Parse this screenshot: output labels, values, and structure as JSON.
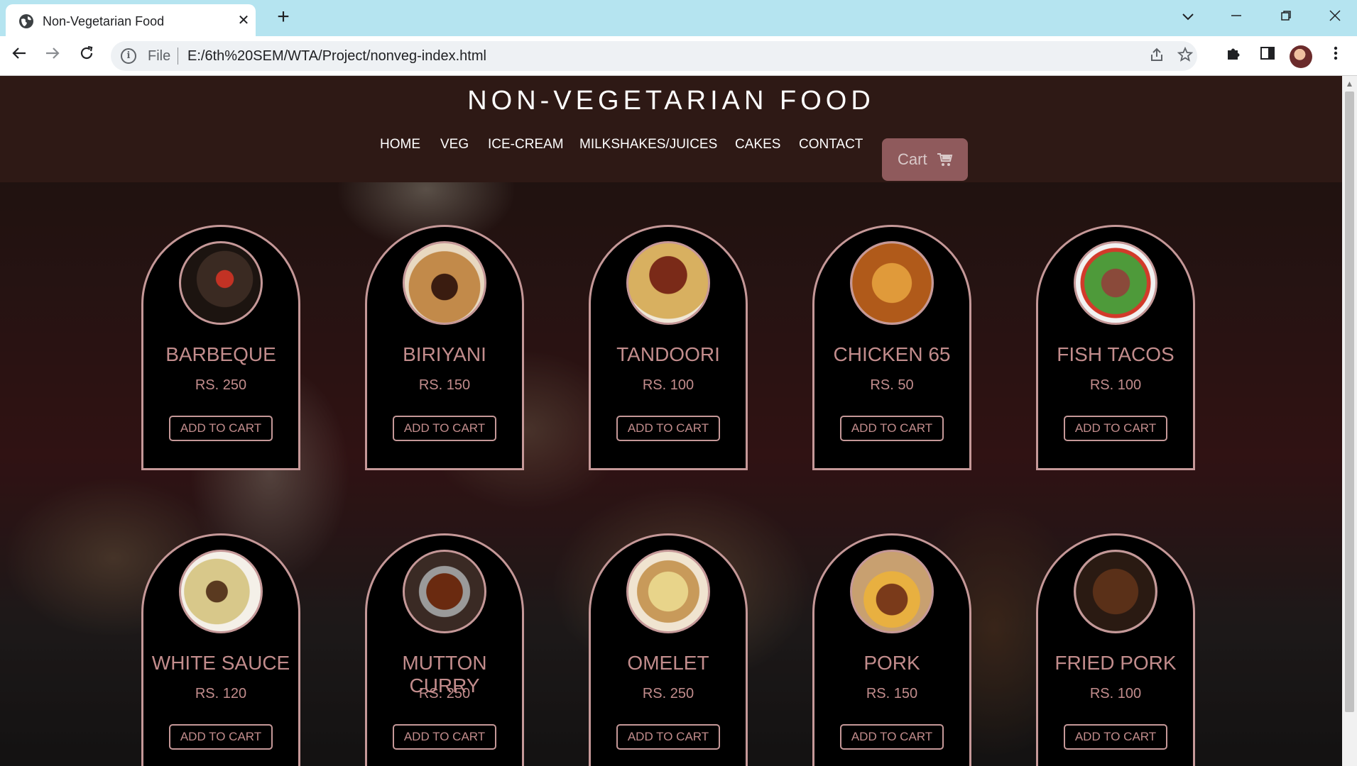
{
  "browser": {
    "tab_title": "Non-Vegetarian Food",
    "tab_close": "✕",
    "new_tab": "+",
    "file_label": "File",
    "url": "E:/6th%20SEM/WTA/Project/nonveg-index.html",
    "icons": [
      "globe-icon",
      "back-icon",
      "forward-icon",
      "reload-icon",
      "info-icon",
      "share-icon",
      "star-icon",
      "extensions-icon",
      "sidepanel-icon",
      "menu-icon",
      "minimize-icon",
      "restore-icon",
      "close-icon"
    ]
  },
  "header": {
    "title": "NON-VEGETARIAN FOOD",
    "nav": [
      "HOME",
      "VEG",
      "ICE-CREAM",
      "MILKSHAKES/JUICES",
      "CAKES",
      "CONTACT"
    ],
    "cart_label": "Cart"
  },
  "colors": {
    "accent": "#c59898",
    "header_bg": "#2e1915",
    "cart_bg": "#8f5a5c",
    "card_bg": "#000000"
  },
  "items": [
    {
      "name": "BARBEQUE",
      "price": "RS. 250",
      "button": "ADD TO CART"
    },
    {
      "name": "BIRIYANI",
      "price": "RS. 150",
      "button": "ADD TO CART"
    },
    {
      "name": "TANDOORI",
      "price": "RS. 100",
      "button": "ADD TO CART"
    },
    {
      "name": "CHICKEN 65",
      "price": "RS. 50",
      "button": "ADD TO CART"
    },
    {
      "name": "FISH TACOS",
      "price": "RS. 100",
      "button": "ADD TO CART"
    },
    {
      "name": "WHITE SAUCE",
      "price": "RS. 120",
      "button": "ADD TO CART"
    },
    {
      "name": "MUTTON CURRY",
      "price": "RS. 250",
      "button": "ADD TO CART"
    },
    {
      "name": "OMELET",
      "price": "RS. 250",
      "button": "ADD TO CART"
    },
    {
      "name": "PORK",
      "price": "RS. 150",
      "button": "ADD TO CART"
    },
    {
      "name": "FRIED PORK",
      "price": "RS. 100",
      "button": "ADD TO CART"
    }
  ]
}
